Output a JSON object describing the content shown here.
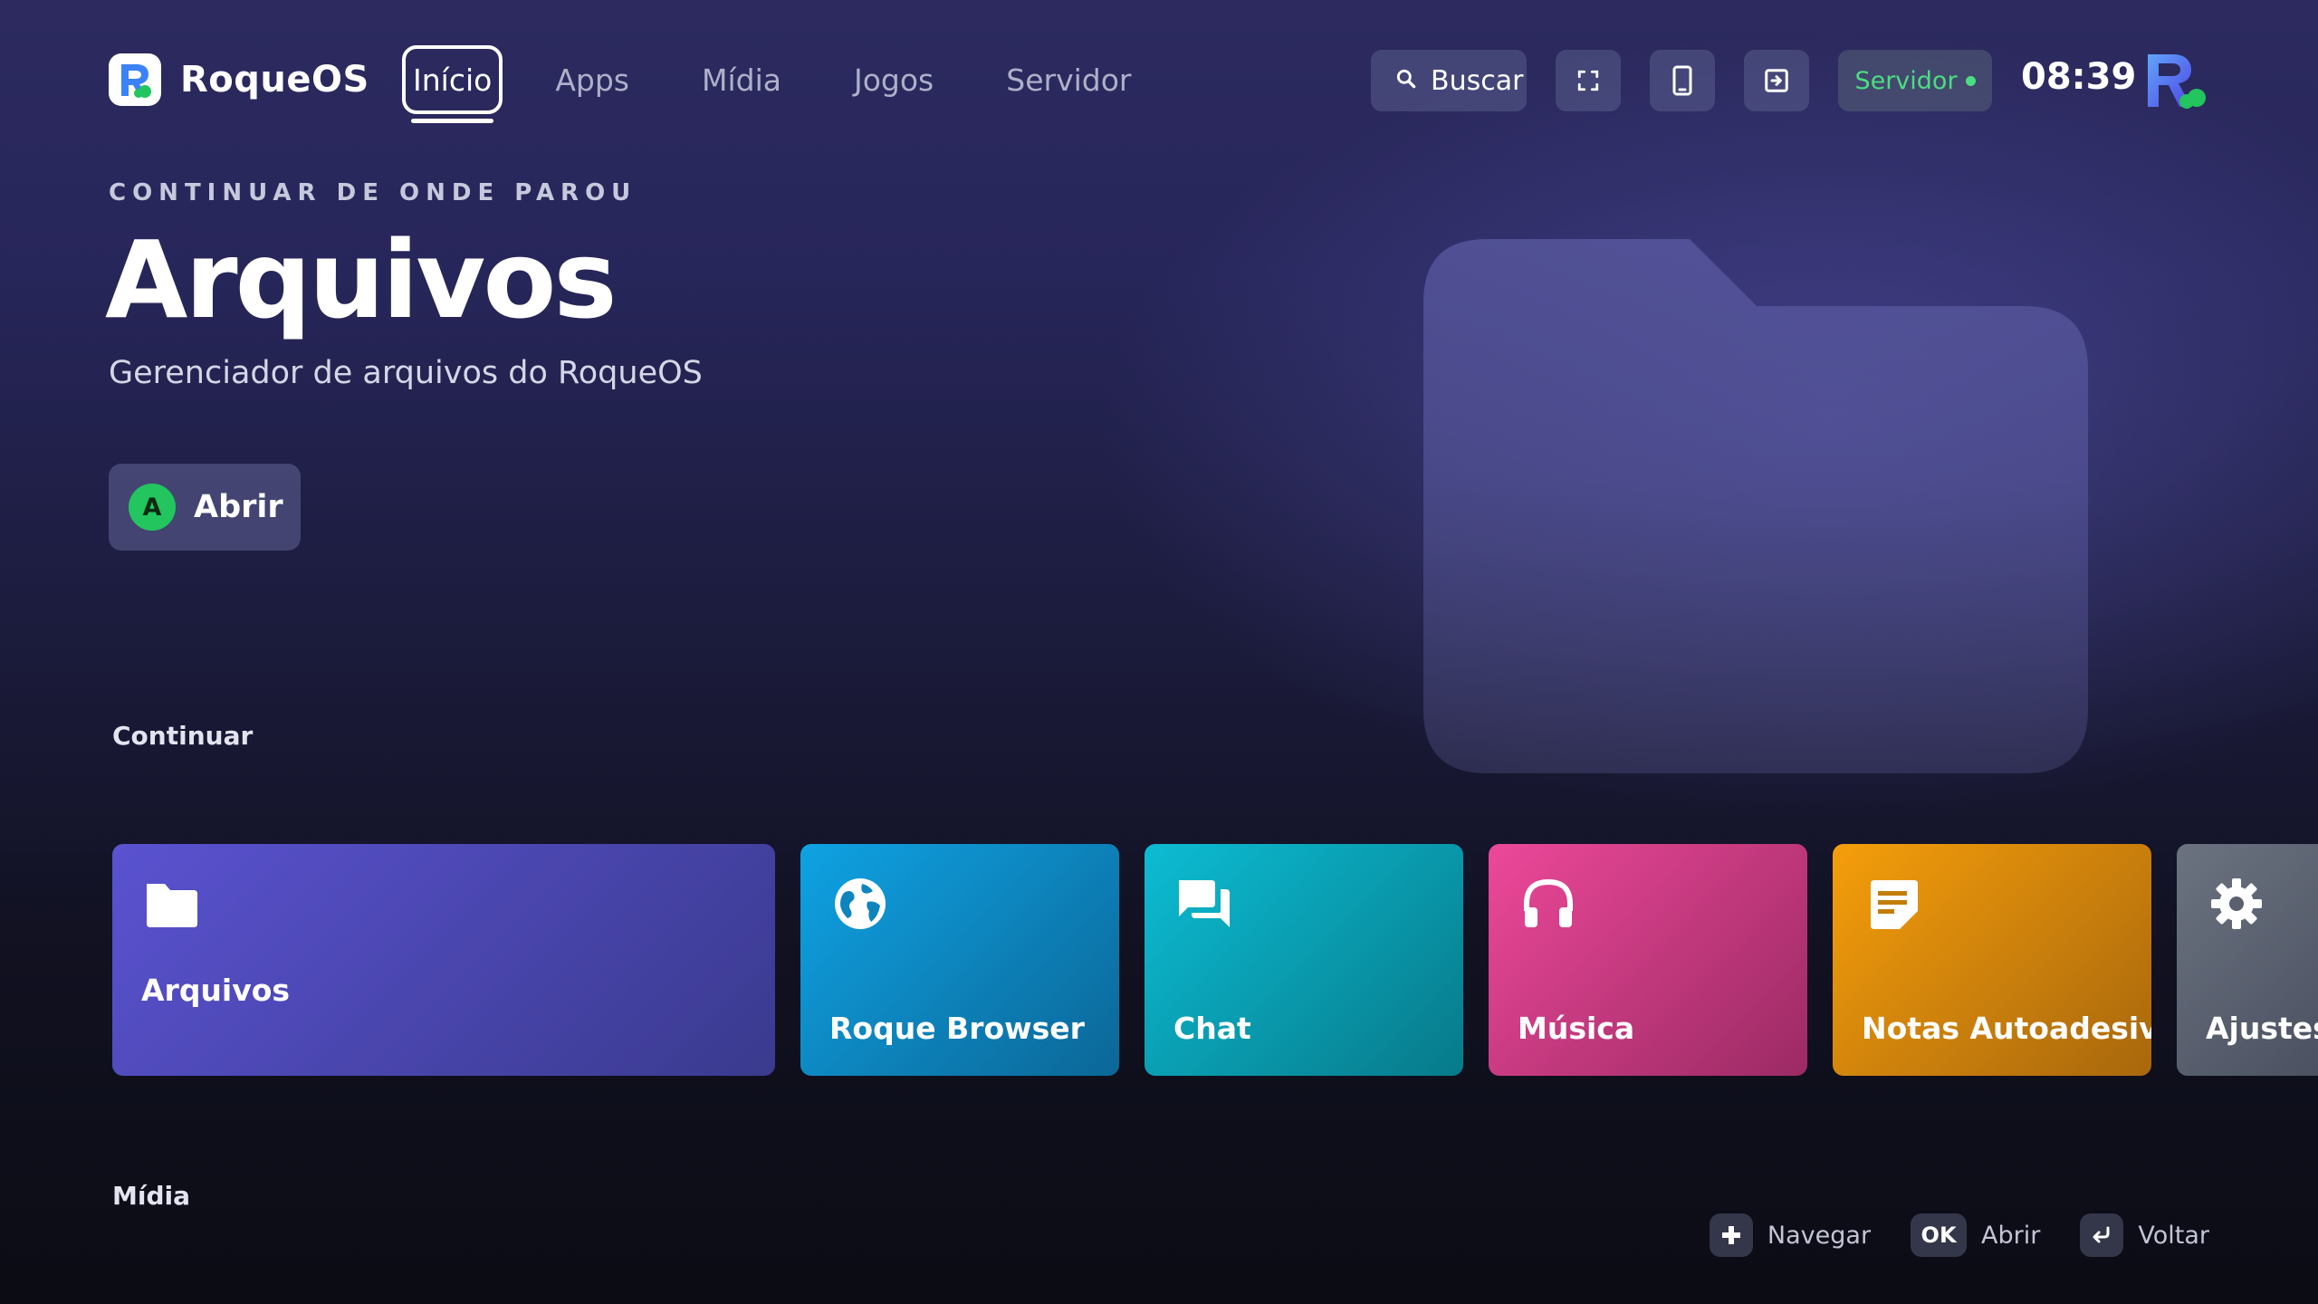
{
  "brand": {
    "name": "RoqueOS",
    "logo_icon": "roqueos-logo-icon"
  },
  "nav": {
    "items": [
      {
        "label": "Início",
        "active": true
      },
      {
        "label": "Apps"
      },
      {
        "label": "Mídia"
      },
      {
        "label": "Jogos"
      },
      {
        "label": "Servidor"
      }
    ]
  },
  "toolbar": {
    "search_label": "Buscar",
    "search_icon": "search-icon",
    "fullscreen_icon": "fullscreen-icon",
    "phone_icon": "phone-icon",
    "exit_icon": "exit-icon",
    "server_label": "Servidor",
    "server_status_color": "#4ade80",
    "clock": "08:39"
  },
  "hero": {
    "eyebrow": "CONTINUAR DE ONDE PAROU",
    "title": "Arquivos",
    "subtitle": "Gerenciador de arquivos do RoqueOS",
    "open_key": "A",
    "open_label": "Abrir",
    "art_icon": "folder-icon"
  },
  "sections": {
    "continue_title": "Continuar",
    "media_title": "Mídia"
  },
  "tiles": [
    {
      "label": "Arquivos",
      "icon": "folder-icon",
      "color_from": "#5a52d0",
      "color_to": "#3a3a8e"
    },
    {
      "label": "Roque Browser",
      "icon": "globe-icon",
      "color_from": "#0fa2e3",
      "color_to": "#0b6797"
    },
    {
      "label": "Chat",
      "icon": "chat-icon",
      "color_from": "#0cbcd3",
      "color_to": "#077a8a"
    },
    {
      "label": "Música",
      "icon": "headphones-icon",
      "color_from": "#ec4899",
      "color_to": "#9b2a64"
    },
    {
      "label": "Notas Autoadesivas",
      "icon": "sticky-note-icon",
      "color_from": "#f59e0b",
      "color_to": "#a8670c"
    },
    {
      "label": "Ajustes",
      "icon": "gear-icon",
      "color_from": "#6b7280",
      "color_to": "#4b5160"
    }
  ],
  "hints": [
    {
      "key": "+",
      "label": "Navegar",
      "icon": "dpad-icon"
    },
    {
      "key": "OK",
      "label": "Abrir"
    },
    {
      "key": "↩",
      "label": "Voltar",
      "icon": "back-icon"
    }
  ]
}
